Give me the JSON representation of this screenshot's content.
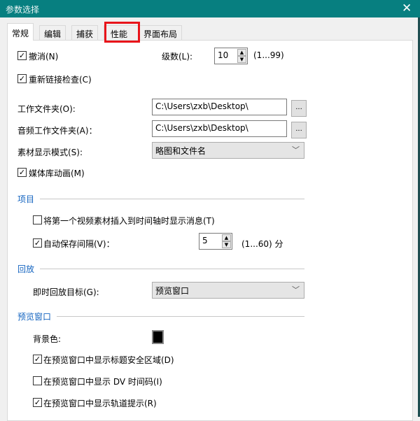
{
  "window": {
    "title": "参数选择",
    "close_icon": "close-icon"
  },
  "tabs": [
    {
      "label": "常规",
      "active": true
    },
    {
      "label": "编辑"
    },
    {
      "label": "捕获"
    },
    {
      "label": "性能",
      "highlighted": true
    },
    {
      "label": "界面布局"
    }
  ],
  "general": {
    "undo": {
      "label": "撤消(N)",
      "checked": true
    },
    "levels": {
      "label": "级数(L):",
      "value": "10",
      "range": "(1...99)"
    },
    "relink": {
      "label": "重新链接检查(C)",
      "checked": true
    },
    "work_folder": {
      "label": "工作文件夹(O):",
      "value": "C:\\Users\\zxb\\Desktop\\",
      "browse": "..."
    },
    "audio_folder": {
      "label": "音频工作文件夹(A)：",
      "value": "C:\\Users\\zxb\\Desktop\\",
      "browse": "..."
    },
    "display_mode": {
      "label": "素材显示模式(S):",
      "value": "略图和文件名"
    },
    "library_anim": {
      "label": "媒体库动画(M)",
      "checked": true
    }
  },
  "project": {
    "heading": "项目",
    "insert_msg": {
      "label": "将第一个视频素材插入到时间轴时显示消息(T)",
      "checked": false
    },
    "autosave": {
      "label": "自动保存间隔(V)：",
      "checked": true,
      "value": "5",
      "range": "(1...60) 分"
    }
  },
  "playback": {
    "heading": "回放",
    "target": {
      "label": "即时回放目标(G):",
      "value": "预览窗口"
    }
  },
  "preview": {
    "heading": "预览窗口",
    "bg_label": "背景色:",
    "bg_color": "#000000",
    "title_safe": {
      "label": "在预览窗口中显示标题安全区域(D)",
      "checked": true
    },
    "dv_timecode": {
      "label": "在预览窗口中显示 DV 时间码(I)",
      "checked": false
    },
    "track_hint": {
      "label": "在预览窗口中显示轨道提示(R)",
      "checked": true
    }
  }
}
